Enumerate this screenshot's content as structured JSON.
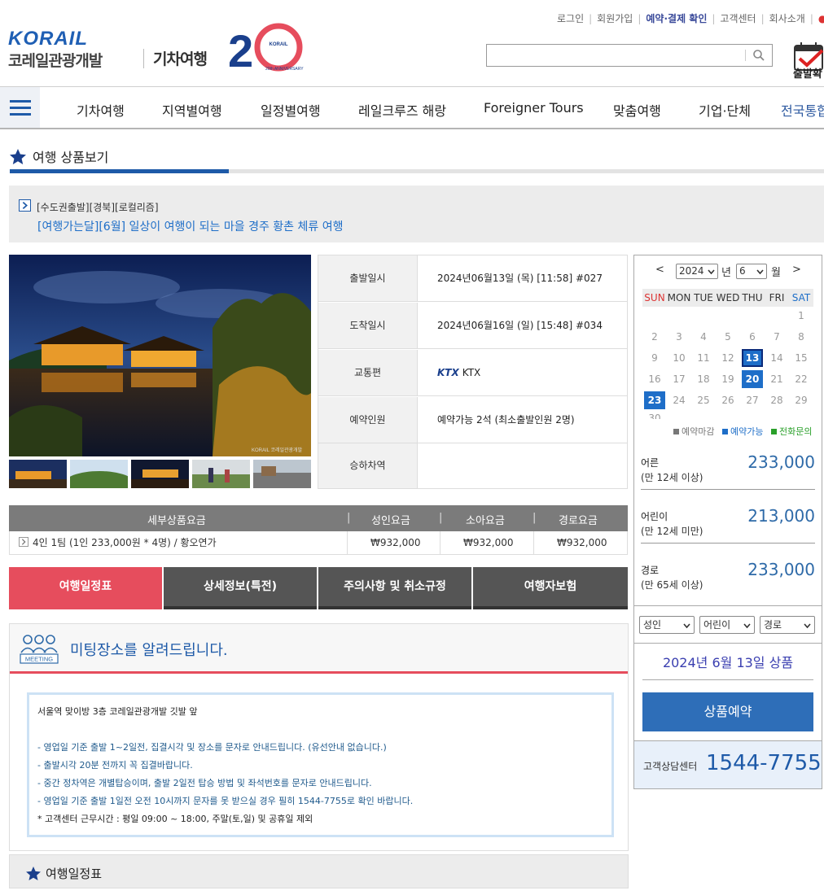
{
  "header": {
    "top_links": [
      "로그인",
      "회원가입",
      "예약·결제 확인",
      "고객센터",
      "회사소개"
    ],
    "logo_en": "KORAIL",
    "logo_ko": "코레일관광개발",
    "logo_sub": "기차여행",
    "anniversary": "20th ANNIVERSARY",
    "search_placeholder": "",
    "depart_label": "출발확"
  },
  "nav": {
    "items": [
      "기차여행",
      "지역별여행",
      "일정별여행",
      "레일크루즈 해랑",
      "Foreigner Tours",
      "맞춤여행",
      "기업·단체",
      "전국통합"
    ]
  },
  "section": {
    "title": "여행 상품보기"
  },
  "product": {
    "tag": "[수도권출발][경북][로컬리즘]",
    "name": "[여행가는달][6월] 일상이 여행이 되는 마을 경주 황촌 체류 여행",
    "image_caption": "KORAIL 코레일관광개발"
  },
  "info": [
    {
      "key": "출발일시",
      "value": "2024년06월13일 (목) [11:58] #027"
    },
    {
      "key": "도착일시",
      "value": "2024년06월16일 (일) [15:48] #034"
    },
    {
      "key": "교통편",
      "value": "KTX",
      "logo": "KTX"
    },
    {
      "key": "예약인원",
      "value": "예약가능 2석 (최소출발인원 2명)"
    },
    {
      "key": "승하차역",
      "value": ""
    }
  ],
  "price_table": {
    "headers": [
      "세부상품요금",
      "성인요금",
      "소아요금",
      "경로요금"
    ],
    "row": {
      "name": "4인 1팀 (1인 233,000원 * 4명) / 황오연가",
      "adult": "₩932,000",
      "child": "₩932,000",
      "senior": "₩932,000"
    }
  },
  "tabs": [
    "여행일정표",
    "상세정보(특전)",
    "주의사항 및 취소규정",
    "여행자보험"
  ],
  "meeting": {
    "title": "미팅장소를 알려드립니다.",
    "icon_label": "MEETING",
    "lines": [
      "서울역 맞이방 3층 코레일관광개발 깃발 앞",
      "- 영업일 기준 출발 1~2일전, 집결시각 및 장소를 문자로 안내드립니다. (유선안내 없습니다.)",
      "- 출발시각 20분 전까지 꼭 집결바랍니다.",
      "- 중간 정차역은 개별탑승이며, 출발 2일전 탑승 방법 및 좌석번호를 문자로 안내드립니다.",
      "-  영업일 기준 출발 1일전 오전 10시까지 문자를 못 받으실 경우 필히 1544-7755로 확인 바랍니다.",
      "  * 고객센터 근무시간 : 평일 09:00 ~ 18:00, 주말(토,일) 및 공휴일 제외"
    ]
  },
  "itinerary_title": "여행일정표",
  "calendar": {
    "prev": "<",
    "next": ">",
    "year": "2024",
    "year_suffix": "년",
    "month": "6",
    "month_suffix": "월",
    "dow": [
      "SUN",
      "MON",
      "TUE",
      "WED",
      "THU",
      "FRI",
      "SAT"
    ],
    "first_weekday": 6,
    "days_in_month": 30,
    "available_days": [
      13,
      20,
      23
    ],
    "selected_day": 13,
    "legend": [
      "예약마감",
      "예약가능",
      "전화문의"
    ]
  },
  "fares": [
    {
      "label": "어른",
      "sub": "(만 12세 이상)",
      "price": "233,000"
    },
    {
      "label": "어린이",
      "sub": "(만 12세 미만)",
      "price": "213,000"
    },
    {
      "label": "경로",
      "sub": "(만 65세 이상)",
      "price": "233,000"
    }
  ],
  "pax_selects": [
    "성인",
    "어린이",
    "경로"
  ],
  "selected_date_label": "2024년 6월 13일 상품",
  "reserve_label": "상품예약",
  "customer_center": {
    "label": "고객상담센터",
    "phone": "1544-7755"
  },
  "colors": {
    "accent_blue": "#1e5aa8",
    "tab_active": "#e64d5d",
    "tab_inactive": "#555555",
    "available": "#1e6ec8"
  }
}
